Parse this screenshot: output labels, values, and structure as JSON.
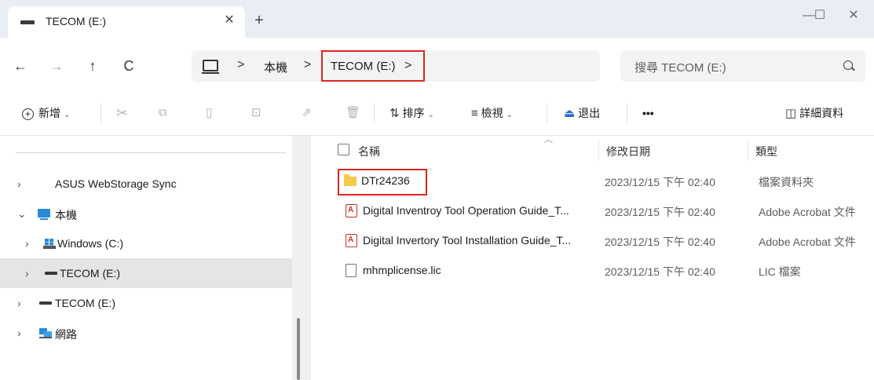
{
  "tab": {
    "title": "TECOM (E:)",
    "close": "✕",
    "new": "+"
  },
  "window": {
    "minimize": "—",
    "maximize": "☐",
    "close": "✕"
  },
  "nav": {
    "back": "←",
    "forward": "→",
    "up": "↑",
    "refresh": "C"
  },
  "address": {
    "sep": ">",
    "crumbs": [
      "本機",
      "TECOM (E:)"
    ]
  },
  "search": {
    "placeholder": "搜尋 TECOM (E:)"
  },
  "toolbar": {
    "new": "新增",
    "sort": "排序",
    "view": "檢視",
    "eject": "退出",
    "more": "•••",
    "details": "詳細資料"
  },
  "sidebar": {
    "items": [
      {
        "label": "ASUS WebStorage Sync"
      },
      {
        "label": "本機"
      },
      {
        "label": "Windows (C:)"
      },
      {
        "label": "TECOM (E:)"
      },
      {
        "label": "TECOM (E:)"
      },
      {
        "label": "網路"
      }
    ]
  },
  "columns": {
    "name": "名稱",
    "modified": "修改日期",
    "type": "類型"
  },
  "files": [
    {
      "name": "DTr24236",
      "modified": "2023/12/15 下午 02:40",
      "type": "檔案資料夾"
    },
    {
      "name": "Digital Inventroy Tool Operation Guide_T...",
      "modified": "2023/12/15 下午 02:40",
      "type": "Adobe Acrobat 文件"
    },
    {
      "name": "Digital Invertory Tool Installation Guide_T...",
      "modified": "2023/12/15 下午 02:40",
      "type": "Adobe Acrobat 文件"
    },
    {
      "name": "mhmplicense.lic",
      "modified": "2023/12/15 下午 02:40",
      "type": "LIC 檔案"
    }
  ],
  "colors": {
    "highlight": "#e0261c",
    "folder": "#f7c948",
    "pdf": "#c4302b",
    "selected": "#e5e5e5"
  }
}
